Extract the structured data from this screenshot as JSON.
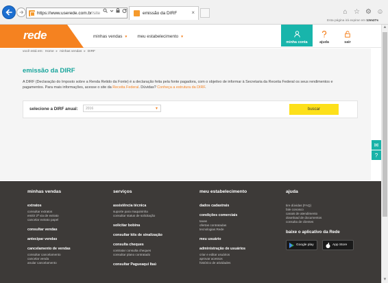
{
  "browser": {
    "url_prefix": "https://www.",
    "url_domain": "userede.com.br",
    "url_suffix": "/site",
    "tab_title": "emissão da DIRF",
    "tab_close": "×"
  },
  "header": {
    "logo": "rede",
    "nav": [
      {
        "label": "minhas vendas"
      },
      {
        "label": "meu estabelecimento"
      }
    ],
    "expire_text": "Esta página irá expirar em",
    "expire_time": "13m27s",
    "actions": [
      {
        "label": "minha conta",
        "icon": "user-icon"
      },
      {
        "label": "ajuda",
        "icon": "question-icon"
      },
      {
        "label": "sair",
        "icon": "lock-icon"
      }
    ]
  },
  "breadcrumb": {
    "prefix": "você está em:",
    "items": [
      "Home",
      "minhas vendas",
      "DIRF"
    ]
  },
  "main": {
    "title": "emissão da DIRF",
    "description_start": "A DIRF (Declaração do Imposto sobre a Renda Retido da Fonte) é a declaração feita pela fonte pagadora, com o objetivo de informar à Secretaria da Receita Federal os seus rendimentos e pagamentos. Para mais informações, acesse o site da",
    "link_receita": "Receita Federal",
    "description_mid": ". Dúvidas?",
    "link_estrutura": "Conheça a estrutura da DIRF",
    "description_end": ".",
    "filter_label": "selecione a DIRF anual:",
    "year_value": "2016",
    "search_button": "buscar"
  },
  "side_tools": {
    "email": "✉",
    "help": "?"
  },
  "footer": {
    "col1": {
      "title": "minhas vendas",
      "sec1": "extratos",
      "sec1_links": [
        "consultar extratos",
        "emitir 2ª via de extrato",
        "cancelar extrato papel"
      ],
      "sec2": "consultar vendas",
      "sec3": "antecipar vendas",
      "sec4": "cancelamento de vendas",
      "sec4_links": [
        "consultar cancelamento",
        "cancelar venda",
        "anular cancelamento"
      ]
    },
    "col2": {
      "title": "serviços",
      "sec1": "assistência técnica",
      "sec1_links": [
        "suporte para maquininha",
        "consultar status de solicitação"
      ],
      "sec2": "solicitar bobina",
      "sec3": "consultar kits de sinalização",
      "sec4": "consulta cheques",
      "sec4_links": [
        "contratar consulta cheques",
        "consultar plano contratado"
      ],
      "sec5": "consultar Pagueaqui Itaú"
    },
    "col3": {
      "title": "meu estabelecimento",
      "sec1": "dados cadastrais",
      "sec2": "condições comerciais",
      "sec2_links": [
        "taxas",
        "ofertas contratadas",
        "tecnologias Rede"
      ],
      "sec3": "meu usuário",
      "sec4": "administração de usuários",
      "sec4_links": [
        "criar e editar usuários",
        "aprovar acessos",
        "histórico de atividades"
      ]
    },
    "col4": {
      "title": "ajuda",
      "links": [
        "tire dúvidas (FAQ)",
        "fale conosco",
        "canais de atendimento",
        "download de documentos",
        "consulta de clientes"
      ],
      "app_title": "baixe o aplicativo da Rede",
      "google_play": "Google play",
      "app_store": "App Store"
    }
  },
  "colors": {
    "orange": "#f58220",
    "teal": "#18b5ab",
    "yellow": "#fde01a",
    "footer_bg": "#3d3a38"
  }
}
